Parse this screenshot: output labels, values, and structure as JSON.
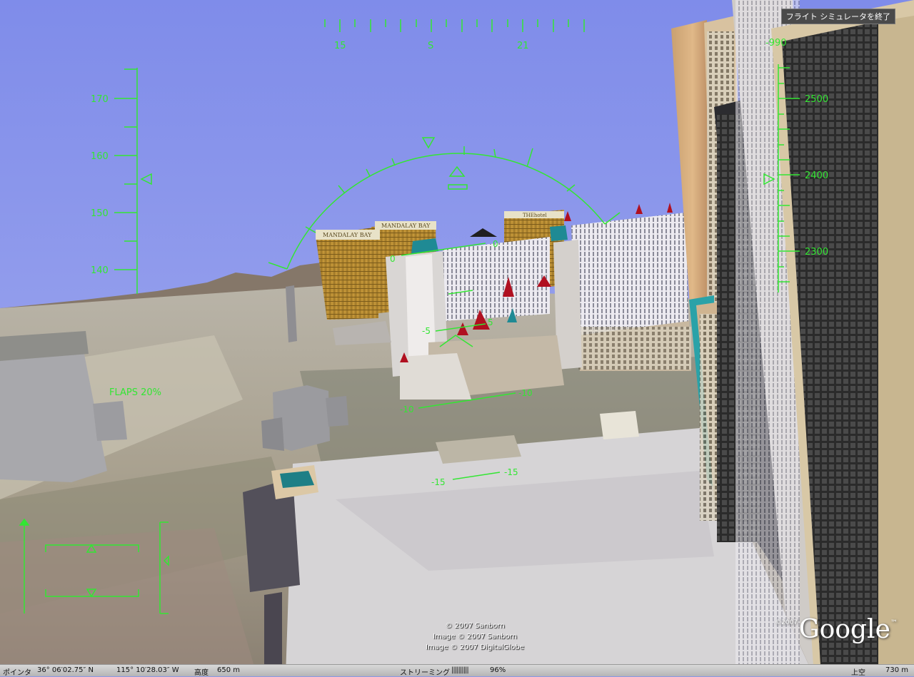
{
  "hud": {
    "heading_labels": [
      "15",
      "S",
      "21"
    ],
    "speed_labels": [
      "170",
      "160",
      "150",
      "140"
    ],
    "altitude_labels": [
      "2500",
      "2400",
      "2300"
    ],
    "vertical_speed": "-990",
    "pitch_labels": {
      "zero_left": "0",
      "zero_right": "0",
      "m5_left": "-5",
      "m5_right": "5",
      "m10_left": "-10",
      "m10_right": "-10",
      "m15_left": "-15",
      "m15_right": "-15"
    },
    "flaps": "FLAPS 20%",
    "color": "#33e633"
  },
  "exit_button": "フライト シミュレータを終了",
  "credits": {
    "line1": "© 2007 Sanborn",
    "line2": "Image © 2007 Sanborn",
    "line3": "Image © 2007 DigitalGlobe"
  },
  "logo": {
    "year": "©2007",
    "name": "Google",
    "tm": "™"
  },
  "status_bar": {
    "pointer_label": "ポインタ",
    "latitude": "36° 06′02.75″ N",
    "longitude": "115° 10′28.03″ W",
    "elevation_label": "高度",
    "elevation": "650 m",
    "streaming_label": "ストリーミング",
    "streaming_bars": "||||||||||",
    "streaming_pct": "96%",
    "eye_label": "上空",
    "eye_alt": "730 m"
  },
  "buildings": [
    "MANDALAY BAY",
    "MANDALAY BAY",
    "THEhotel"
  ]
}
